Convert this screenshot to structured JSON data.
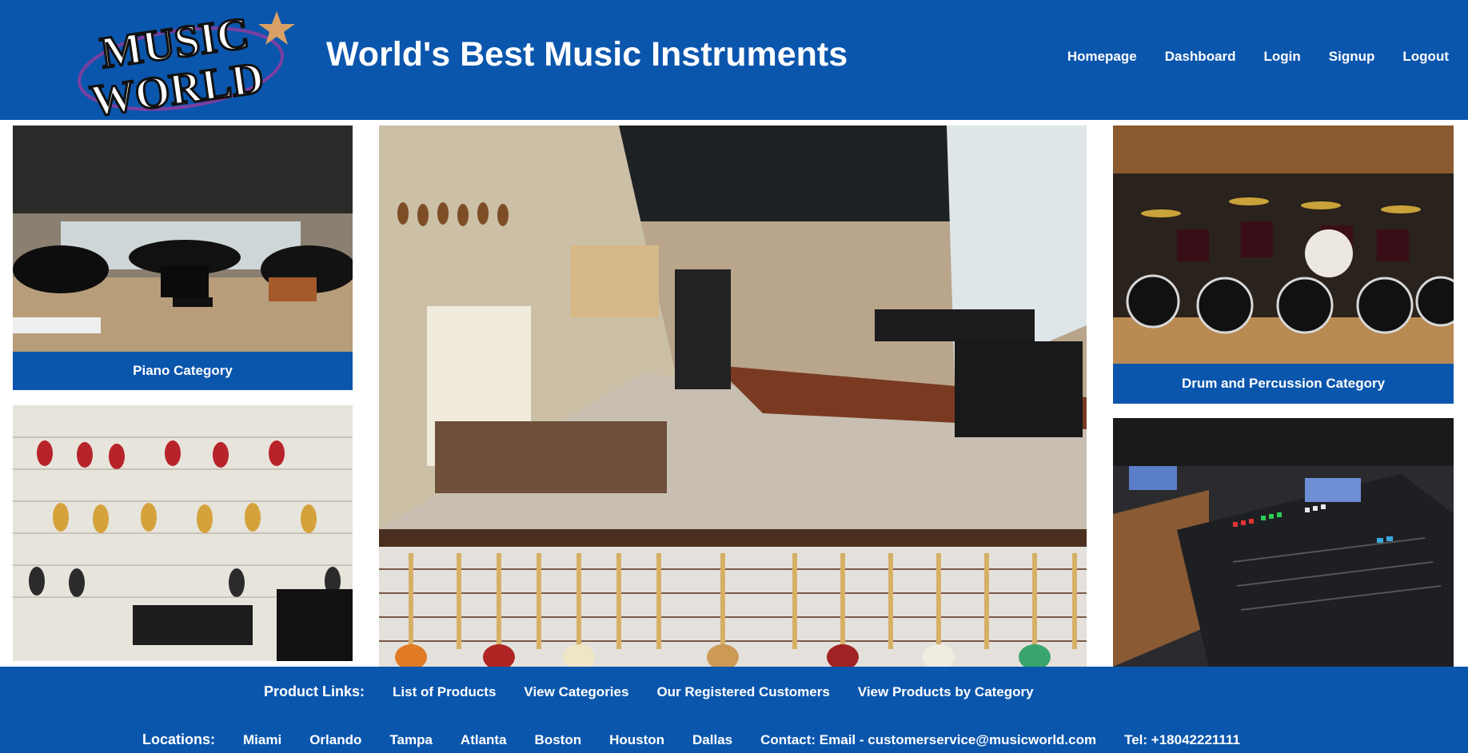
{
  "header": {
    "logo_alt": "Music World",
    "logo_text_line1": "MUSIC",
    "logo_text_line2": "WORLD",
    "title": "World's Best Music Instruments",
    "nav": [
      "Homepage",
      "Dashboard",
      "Login",
      "Signup",
      "Logout"
    ]
  },
  "tiles": {
    "piano_caption": "Piano Category",
    "drum_caption": "Drum and Percussion Category"
  },
  "footer": {
    "product_links_label": "Product Links:",
    "product_links": [
      "List of Products",
      "View Categories",
      "Our Registered Customers",
      "View Products by Category"
    ],
    "locations_label": "Locations:",
    "locations": [
      "Miami",
      "Orlando",
      "Tampa",
      "Atlanta",
      "Boston",
      "Houston",
      "Dallas"
    ],
    "contact": "Contact: Email - customerservice@musicworld.com",
    "tel": "Tel: +18042221111"
  },
  "colors": {
    "brand_blue": "#0b56ad",
    "text": "#ffffff"
  }
}
